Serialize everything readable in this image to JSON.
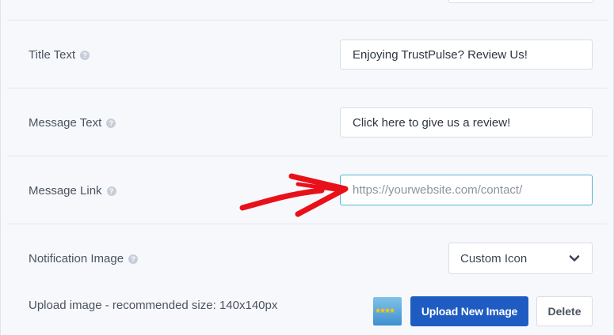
{
  "fields": {
    "title_text": {
      "label": "Title Text",
      "value": "Enjoying TrustPulse? Review Us!"
    },
    "message_text": {
      "label": "Message Text",
      "value": "Click here to give us a review!"
    },
    "message_link": {
      "label": "Message Link",
      "value": "",
      "placeholder": "https://yourwebsite.com/contact/"
    },
    "notification_image": {
      "label": "Notification Image",
      "selected": "Custom Icon"
    }
  },
  "upload": {
    "hint": "Upload image - recommended size: 140x140px",
    "upload_label": "Upload New Image",
    "delete_label": "Delete"
  },
  "help_glyph": "?",
  "colors": {
    "primary_button": "#1f5cc2",
    "focus_border": "#4fb6d8",
    "annotation_arrow": "#e8111a"
  }
}
